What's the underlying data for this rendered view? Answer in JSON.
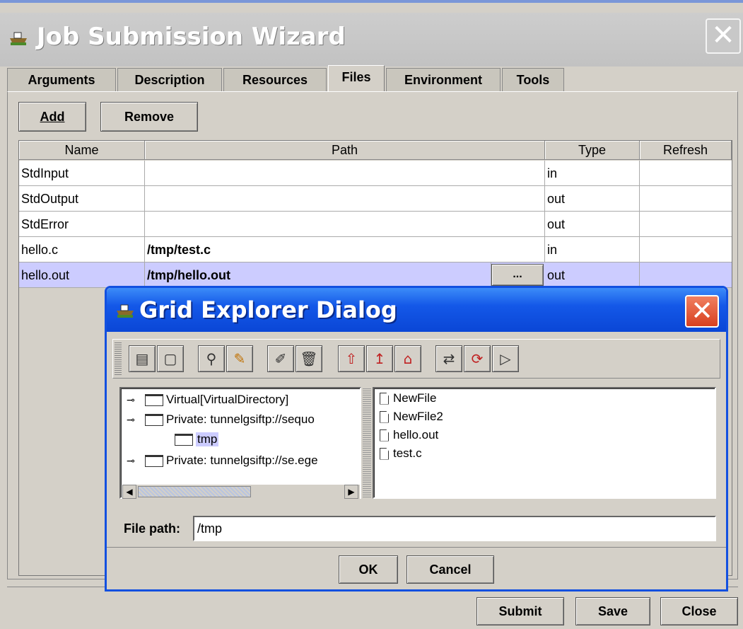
{
  "window": {
    "title": "Job Submission Wizard",
    "close_icon": "close-icon"
  },
  "tabs": [
    {
      "label": "Arguments"
    },
    {
      "label": "Description"
    },
    {
      "label": "Resources"
    },
    {
      "label": "Files",
      "active": true
    },
    {
      "label": "Environment"
    },
    {
      "label": "Tools"
    }
  ],
  "toolbar": {
    "add": "Add",
    "remove": "Remove"
  },
  "table": {
    "columns": [
      "Name",
      "Path",
      "Type",
      "Refresh"
    ],
    "rows": [
      {
        "name": "StdInput",
        "path": "",
        "type": "in",
        "refresh": ""
      },
      {
        "name": "StdOutput",
        "path": "",
        "type": "out",
        "refresh": ""
      },
      {
        "name": "StdError",
        "path": "",
        "type": "out",
        "refresh": ""
      },
      {
        "name": "hello.c",
        "path": "/tmp/test.c",
        "type": "in",
        "refresh": ""
      },
      {
        "name": "hello.out",
        "path": "/tmp/hello.out",
        "type": "out",
        "refresh": "",
        "browse": "...",
        "selected": true
      }
    ]
  },
  "bottom": {
    "submit": "Submit",
    "save": "Save",
    "close": "Close"
  },
  "dialog": {
    "title": "Grid Explorer Dialog",
    "tree": [
      {
        "label": "Virtual[VirtualDirectory]"
      },
      {
        "label": "Private: tunnelgsiftp://sequo"
      },
      {
        "label": "tmp",
        "selected": true
      },
      {
        "label": "Private: tunnelgsiftp://se.ege"
      }
    ],
    "files": [
      "NewFile",
      "NewFile2",
      "hello.out",
      "test.c"
    ],
    "file_path_label": "File path:",
    "file_path_value": "/tmp",
    "ok": "OK",
    "cancel": "Cancel"
  },
  "colors": {
    "dialog_title": "#1458e8",
    "selection": "#ccccff",
    "background": "#d4d0c8"
  }
}
